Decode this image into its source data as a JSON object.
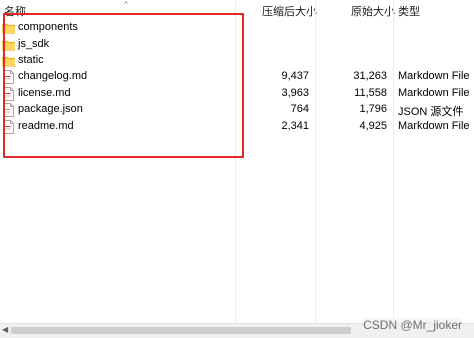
{
  "columns": {
    "name": "名称",
    "compressed_size": "压缩后大小",
    "original_size": "原始大小",
    "type": "类型"
  },
  "files": [
    {
      "name": "components",
      "kind": "folder",
      "compressed": "",
      "original": "",
      "type": ""
    },
    {
      "name": "js_sdk",
      "kind": "folder",
      "compressed": "",
      "original": "",
      "type": ""
    },
    {
      "name": "static",
      "kind": "folder",
      "compressed": "",
      "original": "",
      "type": ""
    },
    {
      "name": "changelog.md",
      "kind": "md",
      "compressed": "9,437",
      "original": "31,263",
      "type": "Markdown File"
    },
    {
      "name": "license.md",
      "kind": "md",
      "compressed": "3,963",
      "original": "11,558",
      "type": "Markdown File"
    },
    {
      "name": "package.json",
      "kind": "json",
      "compressed": "764",
      "original": "1,796",
      "type": "JSON 源文件"
    },
    {
      "name": "readme.md",
      "kind": "md",
      "compressed": "2,341",
      "original": "4,925",
      "type": "Markdown File"
    }
  ],
  "watermark": "CSDN @Mr_jioker",
  "colors": {
    "highlight": "#e0292b",
    "folder": "#f5c33b"
  },
  "icons": {
    "folder": "folder-icon",
    "md": "markdown-file-icon",
    "json": "json-file-icon",
    "sort": "sort-arrow-icon"
  }
}
